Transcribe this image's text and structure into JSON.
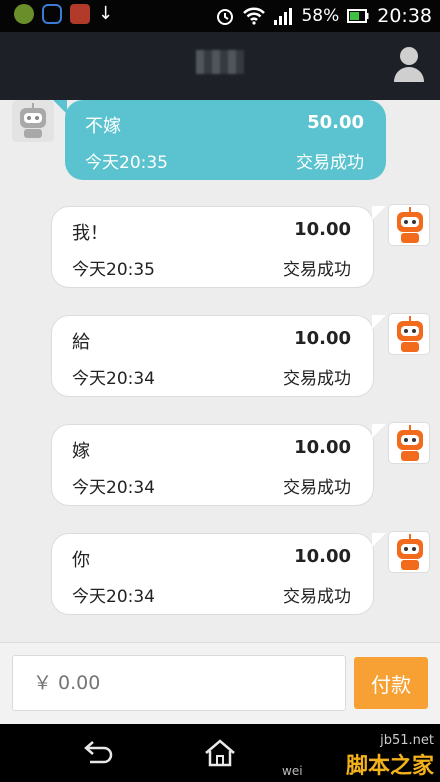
{
  "status_bar": {
    "battery": "58%",
    "time": "20:38"
  },
  "messages": [
    {
      "name": "不嫁",
      "amount": "50.00",
      "time": "今天20:35",
      "status": "交易成功",
      "side": "left"
    },
    {
      "name": "我！",
      "amount": "10.00",
      "time": "今天20:35",
      "status": "交易成功",
      "side": "right"
    },
    {
      "name": "給",
      "amount": "10.00",
      "time": "今天20:34",
      "status": "交易成功",
      "side": "right"
    },
    {
      "name": "嫁",
      "amount": "10.00",
      "time": "今天20:34",
      "status": "交易成功",
      "side": "right"
    },
    {
      "name": "你",
      "amount": "10.00",
      "time": "今天20:34",
      "status": "交易成功",
      "side": "right"
    }
  ],
  "input": {
    "placeholder": "￥ 0.00",
    "pay_label": "付款"
  },
  "watermark": {
    "site": "jb51.net",
    "brand": "脚本之家",
    "partial": "wei"
  },
  "colors": {
    "blue_bubble": "#5bc3cf",
    "pay_button": "#f7a134",
    "title_bar": "#1d2127",
    "avatar_orange": "#f26b1d"
  }
}
